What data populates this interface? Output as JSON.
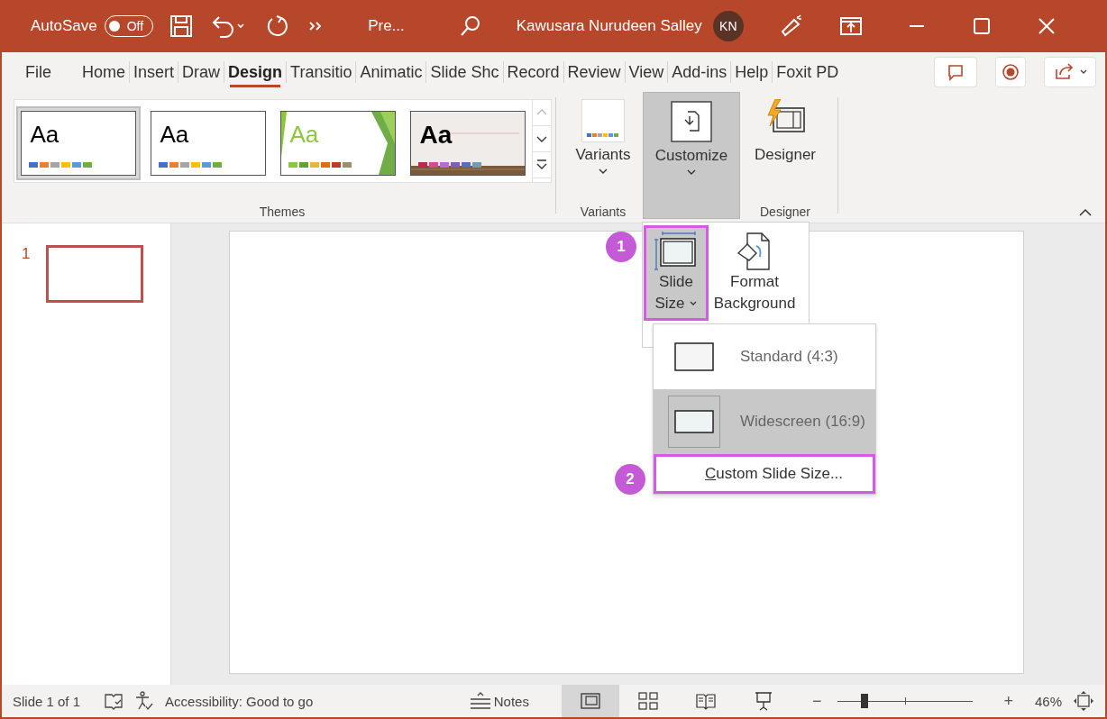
{
  "title_bar": {
    "autosave": {
      "label": "AutoSave",
      "state": "Off",
      "on": false
    },
    "document_title": "Pre...",
    "user_name": "Kawusara Nurudeen Salley",
    "avatar_initials": "KN"
  },
  "tabs": [
    {
      "label": "File",
      "selected": false
    },
    {
      "label": "Home",
      "selected": false
    },
    {
      "label": "Insert",
      "selected": false
    },
    {
      "label": "Draw",
      "selected": false
    },
    {
      "label": "Design",
      "selected": true
    },
    {
      "label": "Transitio",
      "selected": false
    },
    {
      "label": "Animatic",
      "selected": false
    },
    {
      "label": "Slide Shc",
      "selected": false
    },
    {
      "label": "Record",
      "selected": false
    },
    {
      "label": "Review",
      "selected": false
    },
    {
      "label": "View",
      "selected": false
    },
    {
      "label": "Add-ins",
      "selected": false
    },
    {
      "label": "Help",
      "selected": false
    },
    {
      "label": "Foxit PD",
      "selected": false
    }
  ],
  "themes": {
    "label": "Themes",
    "items": [
      {
        "kind": "office",
        "sample": "Aa",
        "selected": true
      },
      {
        "kind": "plain",
        "sample": "Aa",
        "selected": false
      },
      {
        "kind": "green",
        "sample": "Aa",
        "selected": false
      },
      {
        "kind": "wood",
        "sample": "Aa",
        "selected": false
      }
    ]
  },
  "variants": {
    "button": "Variants",
    "label": "Variants"
  },
  "customize": {
    "button": "Customize",
    "pressed": true
  },
  "designer": {
    "button": "Designer",
    "label": "Designer"
  },
  "customize_menu": {
    "items": [
      {
        "kind": "slide_size",
        "lines": [
          "Slide",
          "Size"
        ],
        "selected": true,
        "callout": "1"
      },
      {
        "kind": "format_background",
        "lines": [
          "Format",
          "Background"
        ],
        "selected": false
      }
    ]
  },
  "slide_size_menu": {
    "options": [
      {
        "kind": "standard",
        "label": "Standard (4:3)",
        "selected": false
      },
      {
        "kind": "widescreen",
        "label": "Widescreen (16:9)",
        "selected": true
      }
    ],
    "custom": {
      "label": "Custom Slide Size...",
      "callout": "2"
    }
  },
  "slide_pane": {
    "thumbnails": [
      {
        "number": "1",
        "selected": true
      }
    ]
  },
  "status_bar": {
    "slide_count": "Slide 1 of 1",
    "accessibility": "Accessibility: Good to go",
    "notes": "Notes",
    "views": [
      {
        "kind": "normal",
        "selected": true
      },
      {
        "kind": "sorter",
        "selected": false
      },
      {
        "kind": "reading",
        "selected": false
      },
      {
        "kind": "presenter",
        "selected": false
      }
    ],
    "zoom_out": "−",
    "zoom_in": "+",
    "zoom": {
      "level": 0.2
    },
    "zoom_percent": "46%"
  }
}
